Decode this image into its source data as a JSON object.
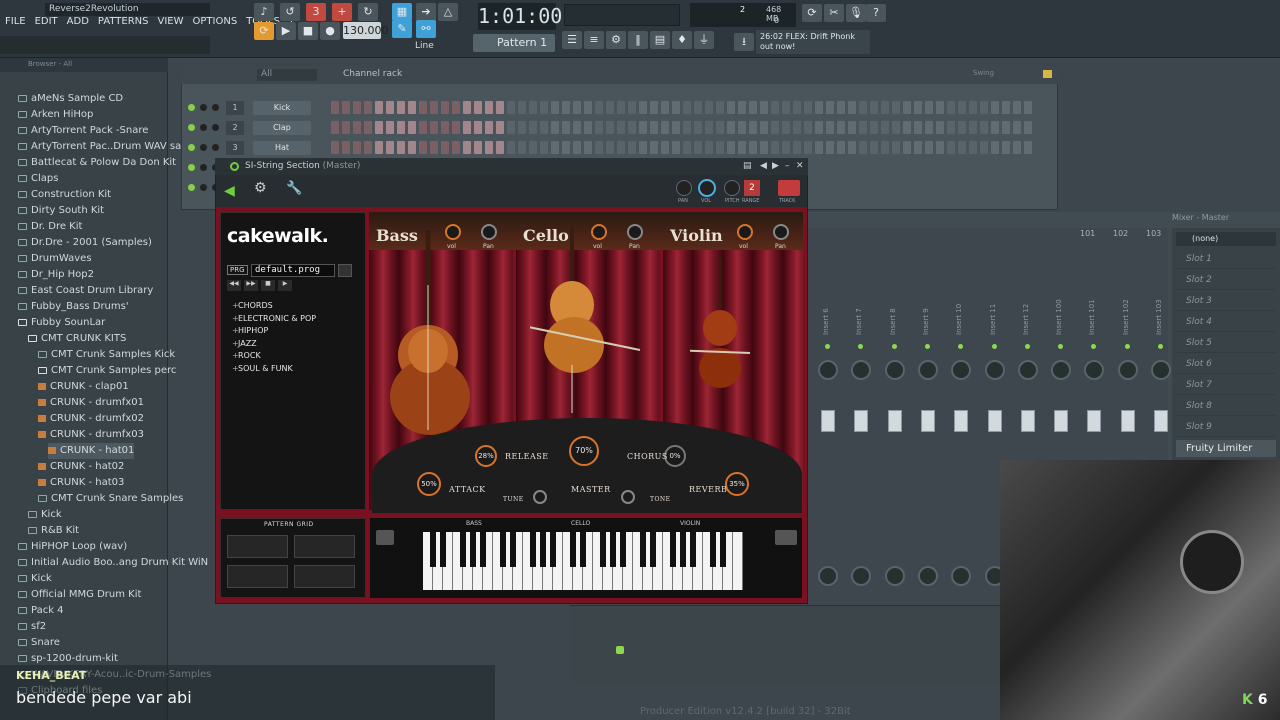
{
  "titlebar": {
    "project": "Reverse2Revolution"
  },
  "menu": [
    "FILE",
    "EDIT",
    "ADD",
    "PATTERNS",
    "VIEW",
    "OPTIONS",
    "TOOLS",
    "?"
  ],
  "transport": {
    "time": "1:01:00",
    "tempo": "130.000",
    "pattern": "Pattern 1",
    "snap": "Line",
    "cpu_count": "2",
    "memory": "468 MB",
    "memory_sub": "0"
  },
  "news": {
    "time": "26:02",
    "text": "FLEX: Drift Phonk out now!"
  },
  "browser": {
    "header": "Browser - All",
    "items": [
      {
        "label": "aMeNs Sample CD",
        "kind": "folder",
        "indent": 0
      },
      {
        "label": "Arken HiHop",
        "kind": "folder",
        "indent": 0
      },
      {
        "label": "ArtyTorrent Pack -Snare",
        "kind": "folder",
        "indent": 0
      },
      {
        "label": "ArtyTorrent Pac..Drum WAV samples",
        "kind": "folder",
        "indent": 0
      },
      {
        "label": "Battlecat & Polow Da Don Kit",
        "kind": "folder",
        "indent": 0
      },
      {
        "label": "Claps",
        "kind": "folder",
        "indent": 0
      },
      {
        "label": "Construction Kit",
        "kind": "folder",
        "indent": 0
      },
      {
        "label": "Dirty South Kit",
        "kind": "folder",
        "indent": 0
      },
      {
        "label": "Dr. Dre Kit",
        "kind": "folder",
        "indent": 0
      },
      {
        "label": "Dr.Dre - 2001 (Samples)",
        "kind": "folder",
        "indent": 0
      },
      {
        "label": "DrumWaves",
        "kind": "folder",
        "indent": 0
      },
      {
        "label": "Dr_Hip Hop2",
        "kind": "folder",
        "indent": 0
      },
      {
        "label": "East Coast Drum Library",
        "kind": "folder",
        "indent": 0
      },
      {
        "label": "Fubby_Bass Drums'",
        "kind": "folder",
        "indent": 0
      },
      {
        "label": "Fubby SounLar",
        "kind": "ofolder",
        "indent": 0
      },
      {
        "label": "CMT CRUNK KITS",
        "kind": "ofolder",
        "indent": 1
      },
      {
        "label": "CMT Crunk Samples Kick",
        "kind": "folder",
        "indent": 2
      },
      {
        "label": "CMT Crunk Samples perc",
        "kind": "ofolder",
        "indent": 2
      },
      {
        "label": "CRUNK - clap01",
        "kind": "file",
        "indent": 2
      },
      {
        "label": "CRUNK - drumfx01",
        "kind": "file",
        "indent": 2
      },
      {
        "label": "CRUNK - drumfx02",
        "kind": "file",
        "indent": 2
      },
      {
        "label": "CRUNK - drumfx03",
        "kind": "file",
        "indent": 2
      },
      {
        "label": "CRUNK - hat01",
        "kind": "file",
        "indent": 3
      },
      {
        "label": "CRUNK - hat02",
        "kind": "file",
        "indent": 2
      },
      {
        "label": "CRUNK - hat03",
        "kind": "file",
        "indent": 2
      },
      {
        "label": "CMT Crunk Snare Samples",
        "kind": "folder",
        "indent": 2
      },
      {
        "label": "Kick",
        "kind": "folder",
        "indent": 1
      },
      {
        "label": "R&B Kit",
        "kind": "folder",
        "indent": 1
      },
      {
        "label": "HiPHOP Loop (wav)",
        "kind": "folder",
        "indent": 0
      },
      {
        "label": "Initial Audio Boo..ang Drum Kit WiN",
        "kind": "folder",
        "indent": 0
      },
      {
        "label": "Kick",
        "kind": "folder",
        "indent": 0
      },
      {
        "label": "Official MMG Drum Kit",
        "kind": "folder",
        "indent": 0
      },
      {
        "label": "Pack 4",
        "kind": "folder",
        "indent": 0
      },
      {
        "label": "sf2",
        "kind": "folder",
        "indent": 0
      },
      {
        "label": "Snare",
        "kind": "folder",
        "indent": 0
      },
      {
        "label": "sp-1200-drum-kit",
        "kind": "folder",
        "indent": 0
      },
      {
        "label": "WAVBVKERY-Acou..ic-Drum-Samples",
        "kind": "folder",
        "indent": 0
      },
      {
        "label": "Clipboard files",
        "kind": "folder",
        "indent": 0
      }
    ]
  },
  "chat": {
    "name": "KEHA_BEAT",
    "message": "bendede pepe var abi"
  },
  "channel_rack": {
    "title": "Channel rack",
    "filter": "All",
    "swing": "Swing",
    "channels": [
      {
        "num": "1",
        "name": "Kick"
      },
      {
        "num": "2",
        "name": "Clap"
      },
      {
        "num": "3",
        "name": "Hat"
      }
    ]
  },
  "plugin": {
    "title": "SI-String Section",
    "title_suffix": "(Master)",
    "brand": "cakewalk.",
    "prg_label": "PRG",
    "program": "default.prog",
    "categories": [
      "CHORDS",
      "ELECTRONIC & POP",
      "HIPHOP",
      "JAZZ",
      "ROCK",
      "SOUL & FUNK"
    ],
    "top_knobs": {
      "pan": "PAN",
      "vol": "VOL",
      "pitch": "PITCH",
      "range": "RANGE",
      "track": "TRACK",
      "range_value": "2"
    },
    "sections": [
      {
        "name": "Bass",
        "vol": "vol",
        "pan": "Pan"
      },
      {
        "name": "Cello",
        "vol": "vol",
        "pan": "Pan"
      },
      {
        "name": "Violin",
        "vol": "vol",
        "pan": "Pan"
      }
    ],
    "controls": {
      "release_value": "28%",
      "release_label": "RELEASE",
      "master_value": "70%",
      "master_label": "MASTER",
      "chorus_value": "0%",
      "chorus_label": "CHORUS",
      "attack_value": "50%",
      "attack_label": "ATTACK",
      "reverb_value": "35%",
      "reverb_label": "REVERB",
      "tune_label": "TUNE",
      "tone_label": "TONE"
    },
    "pattern_grid_label": "PATTERN GRID",
    "key_sections": [
      "BASS",
      "CELLO",
      "VIOLIN"
    ]
  },
  "mixer": {
    "title": "Mixer - Master",
    "routing": "(none)",
    "tracks": [
      "Insert 6",
      "Insert 7",
      "Insert 8",
      "Insert 9",
      "Insert 10",
      "Insert 11",
      "Insert 12",
      "Insert 100",
      "Insert 101",
      "Insert 102",
      "Insert 103"
    ],
    "track_nums": [
      "101",
      "102",
      "103"
    ],
    "slots": [
      "Slot 1",
      "Slot 2",
      "Slot 3",
      "Slot 4",
      "Slot 5",
      "Slot 6",
      "Slot 7",
      "Slot 8",
      "Slot 9"
    ],
    "limiter": "Fruity Limiter"
  },
  "statusbar": {
    "text": "Producer Edition v12.4.2 [build 32] - 32Bit"
  },
  "webcam_badge": "6"
}
